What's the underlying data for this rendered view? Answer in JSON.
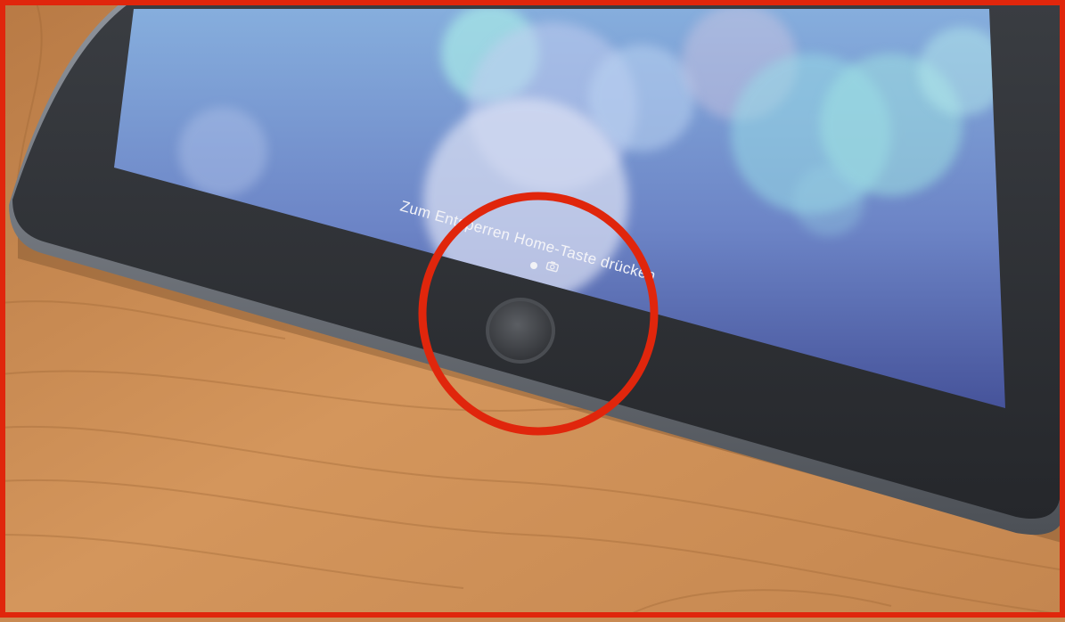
{
  "lock_screen": {
    "unlock_hint": "Zum Entsperren Home-Taste drücken",
    "page_indicator": {
      "pages": 1,
      "active": 1
    },
    "camera_icon": "camera-icon"
  },
  "annotation": {
    "highlight_target": "home-button",
    "color": "#e0260c"
  },
  "colors": {
    "wood": "#c98a52",
    "bezel": "#2f3236",
    "frame_border": "#e0260c",
    "wallpaper_top": "#7fa6d6",
    "wallpaper_bottom": "#3e4a8c"
  }
}
